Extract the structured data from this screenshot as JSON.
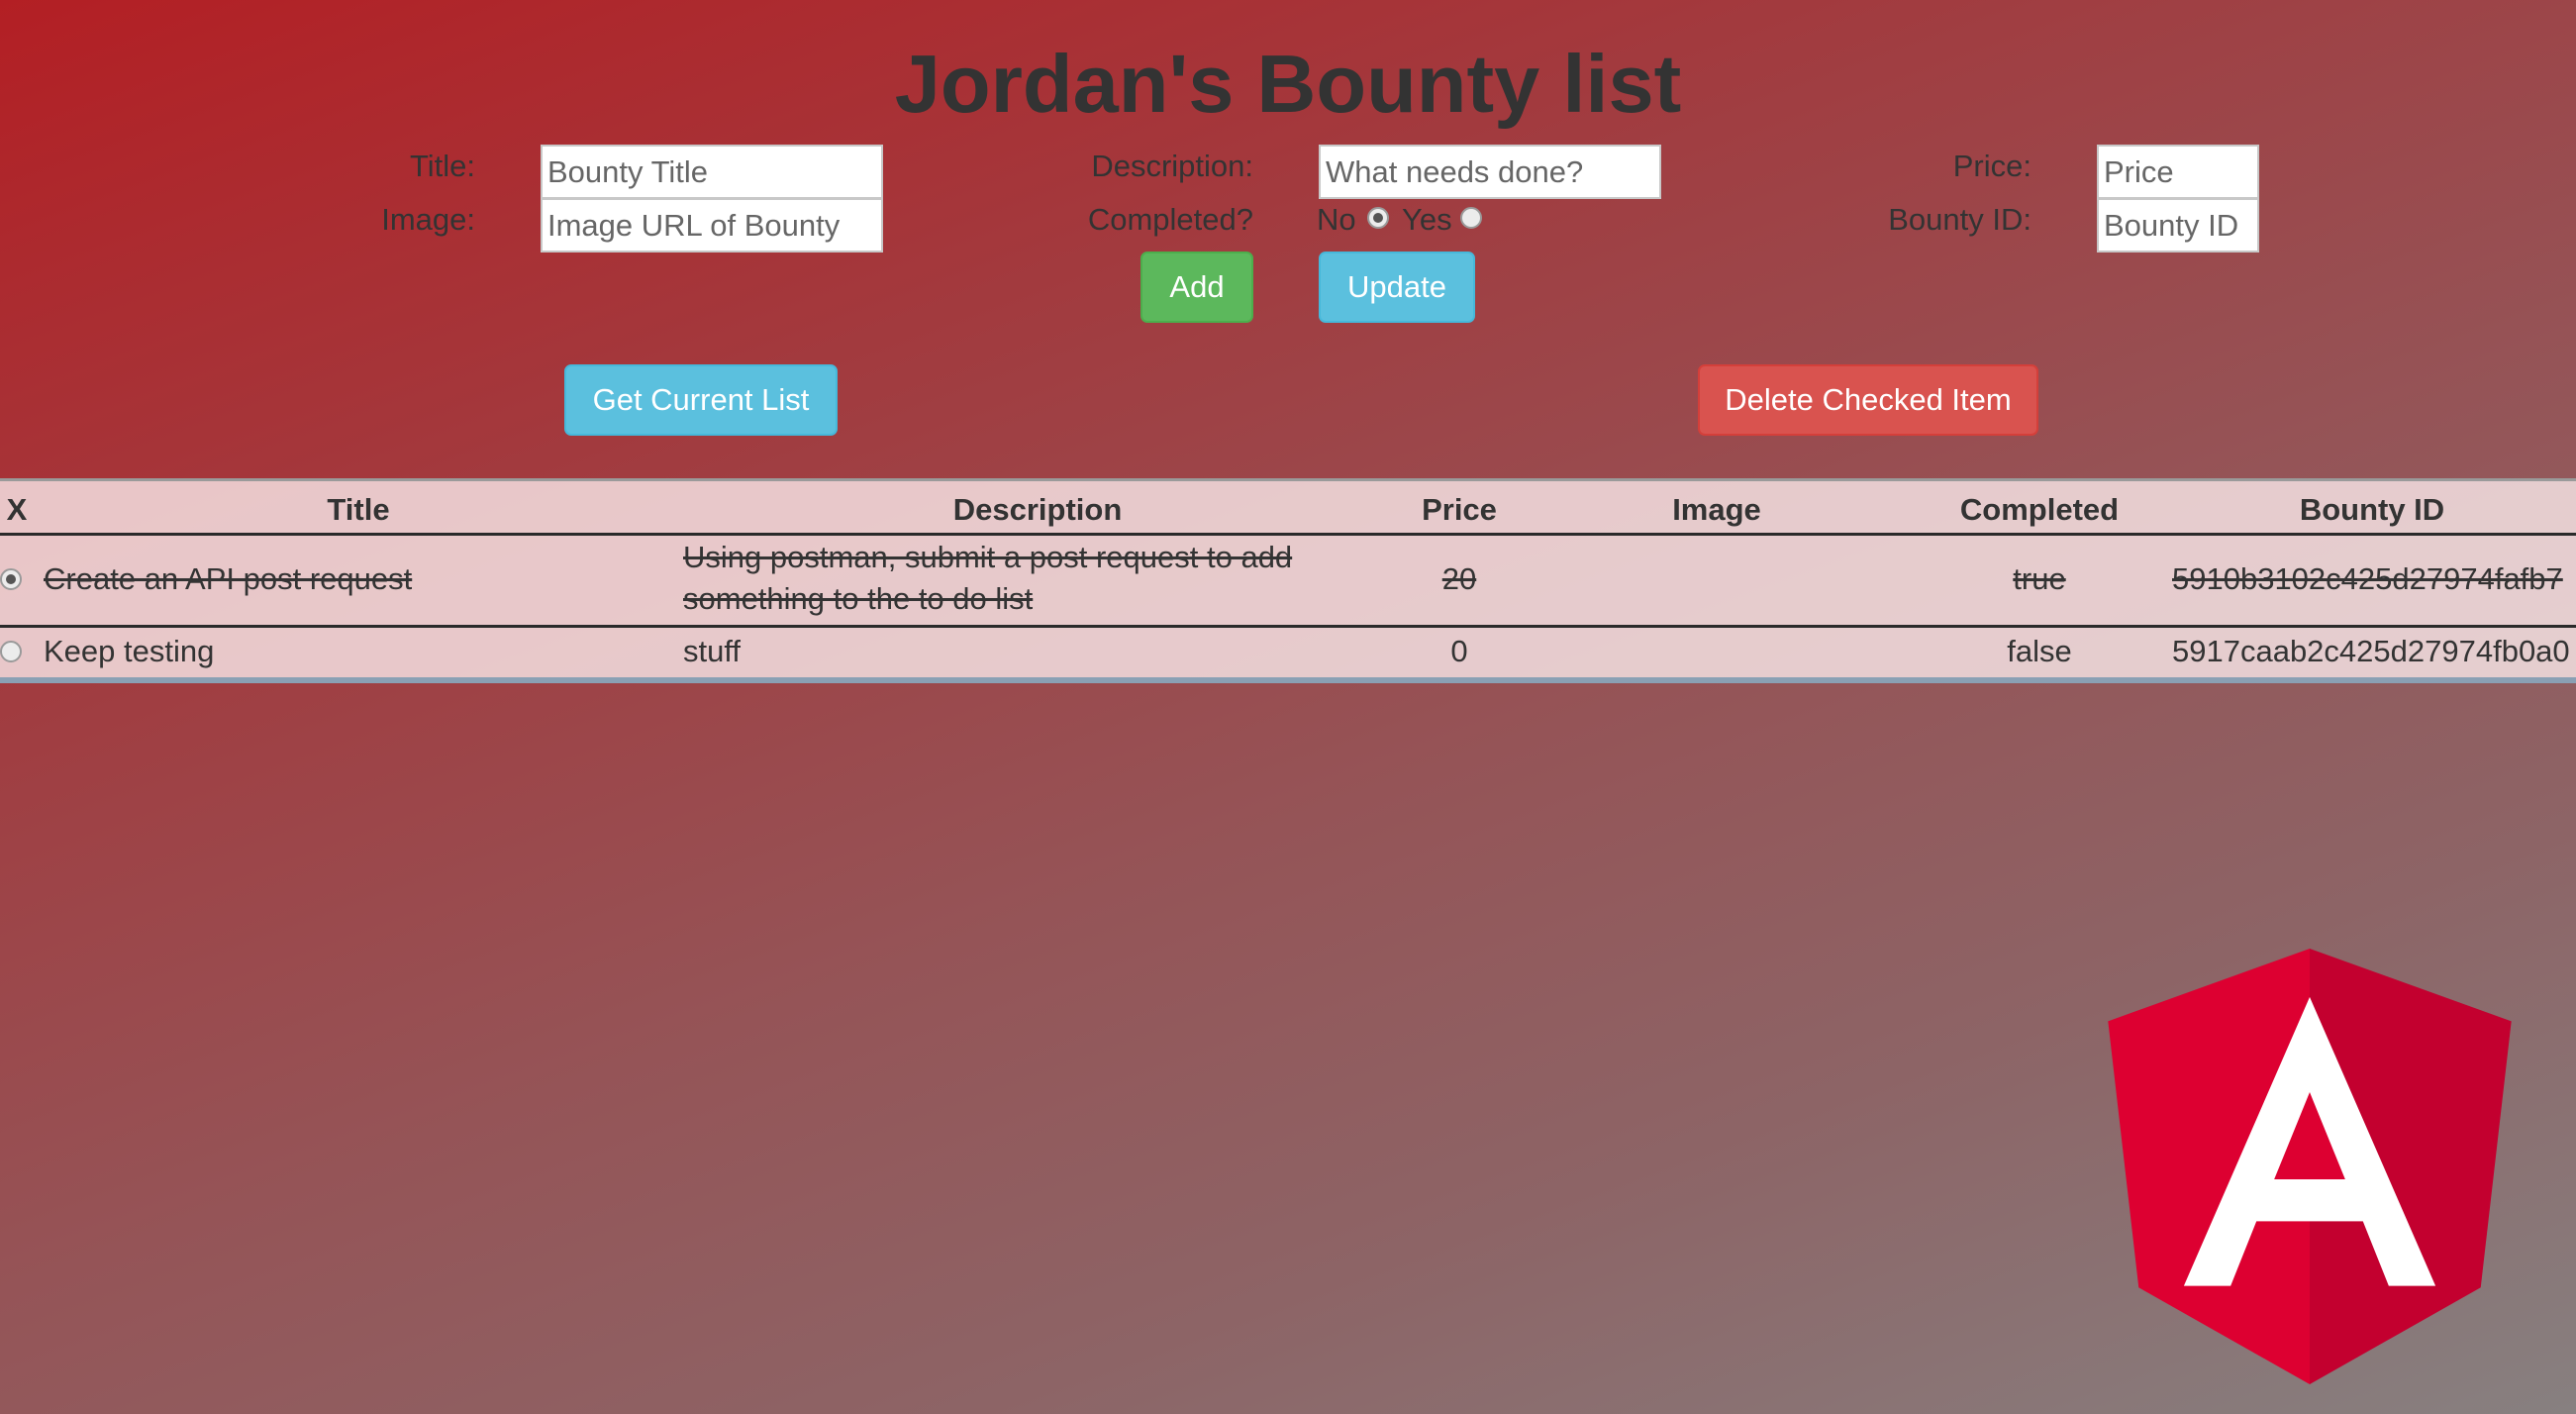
{
  "page": {
    "title": "Jordan's Bounty list"
  },
  "form": {
    "title_label": "Title:",
    "title_placeholder": "Bounty Title",
    "image_label": "Image:",
    "image_placeholder": "Image URL of Bounty",
    "description_label": "Description:",
    "description_placeholder": "What needs done?",
    "completed_label": "Completed?",
    "completed_no": "No",
    "completed_yes": "Yes",
    "completed_selected": "No",
    "price_label": "Price:",
    "price_placeholder": "Price",
    "bounty_id_label": "Bounty ID:",
    "bounty_id_placeholder": "Bounty ID"
  },
  "buttons": {
    "add": "Add",
    "update": "Update",
    "get_list": "Get Current List",
    "delete": "Delete Checked Item"
  },
  "table": {
    "headers": {
      "x": "X",
      "title": "Title",
      "description": "Description",
      "price": "Price",
      "image": "Image",
      "completed": "Completed",
      "bounty_id": "Bounty ID"
    },
    "rows": [
      {
        "checked": true,
        "title": "Create an API post request",
        "description": "Using postman, submit a post request to add something to the to do list",
        "price": "20",
        "image": "",
        "completed": "true",
        "bounty_id": "5910b3102c425d27974fafb7"
      },
      {
        "checked": false,
        "title": "Keep testing",
        "description": "stuff",
        "price": "0",
        "image": "",
        "completed": "false",
        "bounty_id": "5917caab2c425d27974fb0a0"
      }
    ]
  },
  "colors": {
    "add_button": "#5cb85c",
    "info_button": "#5bc0de",
    "delete_button": "#d9534f",
    "logo_red": "#dd0031",
    "logo_dark_red": "#c3002f"
  },
  "logo": {
    "icon": "angular-logo-icon",
    "letter": "A"
  }
}
